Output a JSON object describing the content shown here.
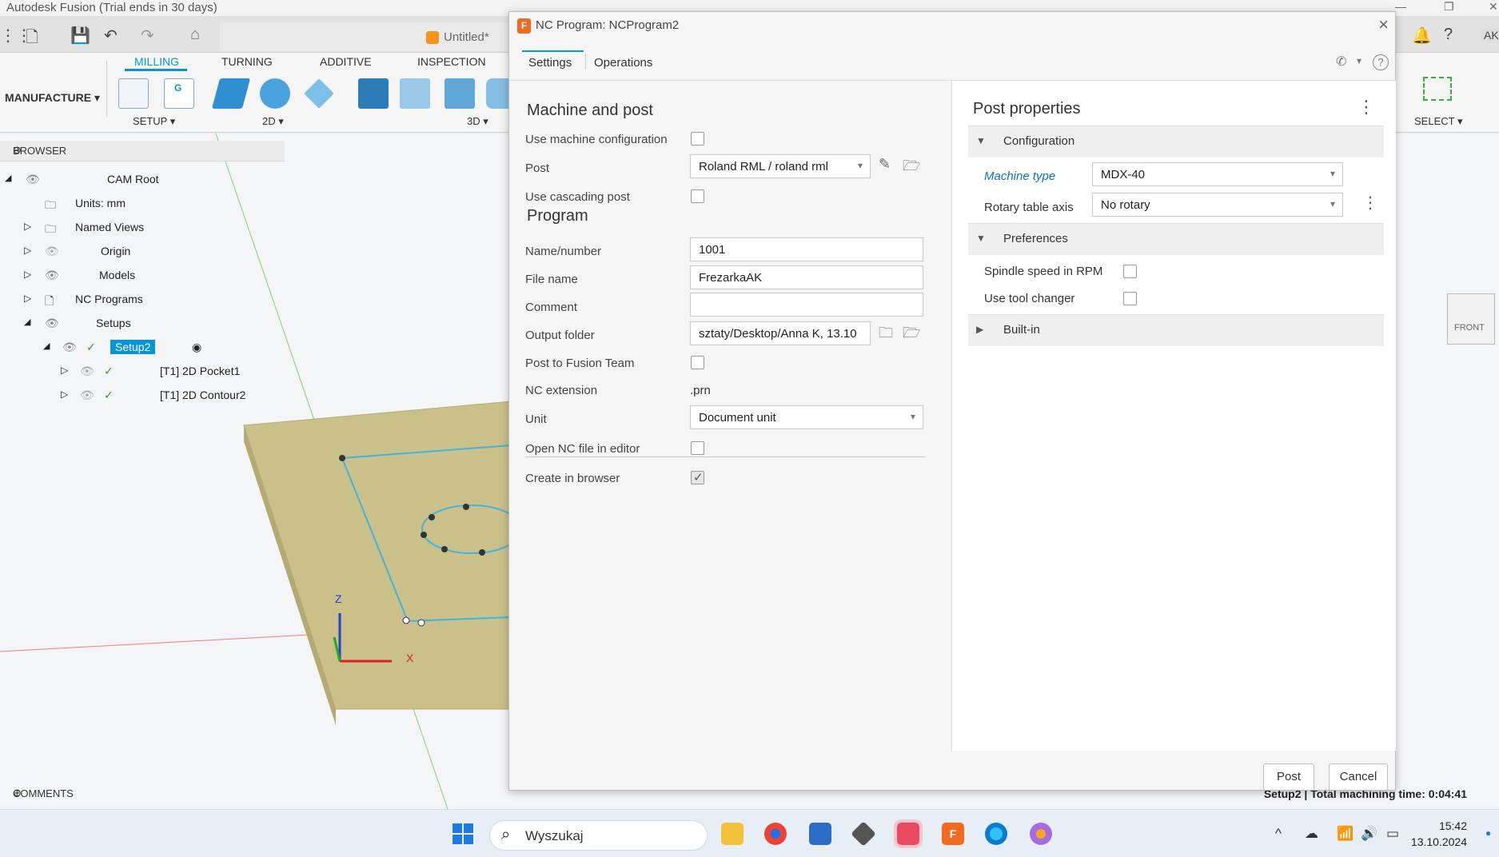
{
  "app": {
    "window_title": "Autodesk Fusion (Trial ends in 30 days)",
    "document_name": "Untitled*",
    "workspace": "MANUFACTURE",
    "ribbon_tabs": [
      "MILLING",
      "TURNING",
      "ADDITIVE",
      "INSPECTION"
    ],
    "ribbon_groups": [
      "SETUP ▾",
      "2D ▾",
      "3D ▾"
    ],
    "select_label": "SELECT ▾",
    "user_initials": "AK",
    "viewcube_label": "FRONT"
  },
  "browser": {
    "title": "BROWSER",
    "items": [
      {
        "label": "CAM Root"
      },
      {
        "label": "Units: mm"
      },
      {
        "label": "Named Views"
      },
      {
        "label": "Origin"
      },
      {
        "label": "Models"
      },
      {
        "label": "NC Programs"
      },
      {
        "label": "Setups"
      },
      {
        "label": "Setup2"
      },
      {
        "label": "[T1] 2D Pocket1"
      },
      {
        "label": "[T1] 2D Contour2"
      }
    ]
  },
  "comments_label": "COMMENTS",
  "status": {
    "machining_time": "Setup2 | Total machining time: 0:04:41"
  },
  "axes": {
    "z": "Z",
    "x": "X"
  },
  "dialog": {
    "title": "NC Program: NCProgram2",
    "tabs": [
      "Settings",
      "Operations"
    ],
    "machine_and_post": {
      "heading": "Machine and post",
      "use_machine_config_label": "Use machine configuration",
      "post_label": "Post",
      "post_value": "Roland RML / roland rml",
      "use_cascading_label": "Use cascading post"
    },
    "program": {
      "heading": "Program",
      "name_label": "Name/number",
      "name_value": "1001",
      "file_label": "File name",
      "file_value": "FrezarkaAK",
      "comment_label": "Comment",
      "comment_value": "",
      "output_label": "Output folder",
      "output_value": "sztaty/Desktop/Anna K, 13.10",
      "post_team_label": "Post to Fusion Team",
      "nc_ext_label": "NC extension",
      "nc_ext_value": ".prn",
      "unit_label": "Unit",
      "unit_value": "Document unit",
      "open_nc_label": "Open NC file in editor",
      "create_browser_label": "Create in browser",
      "create_browser_checked": true
    },
    "post_properties": {
      "heading": "Post properties",
      "configuration": "Configuration",
      "machine_type_label": "Machine type",
      "machine_type_value": "MDX-40",
      "rotary_label": "Rotary table axis",
      "rotary_value": "No rotary",
      "preferences": "Preferences",
      "spindle_label": "Spindle speed in RPM",
      "tool_changer_label": "Use tool changer",
      "built_in": "Built-in"
    },
    "buttons": {
      "post": "Post",
      "cancel": "Cancel"
    }
  },
  "taskbar": {
    "search_placeholder": "Wyszukaj",
    "time": "15:42",
    "date": "13.10.2024"
  },
  "colors": {
    "accent": "#0696d7",
    "fusion_orange": "#f26a20",
    "stock_fill": "#c9c08a"
  }
}
